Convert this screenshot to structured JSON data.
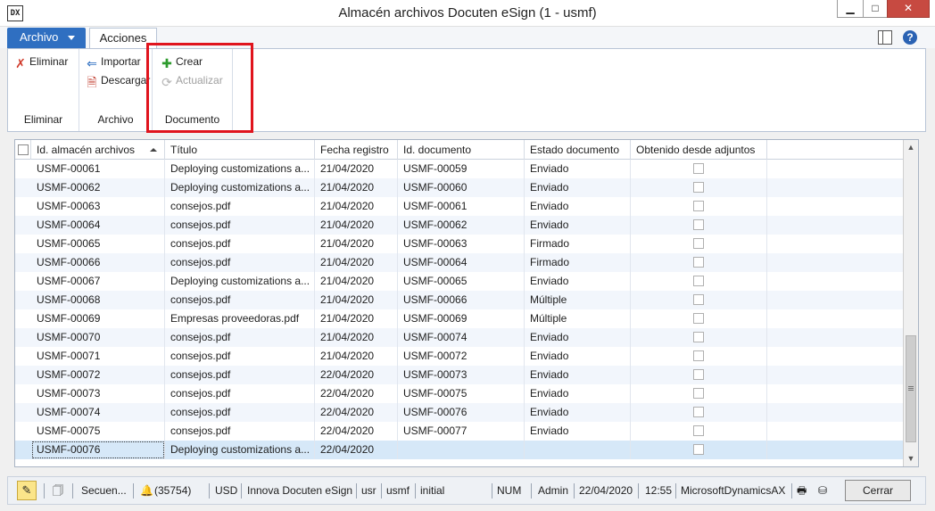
{
  "window": {
    "title": "Almacén archivos Docuten eSign (1 - usmf)",
    "app_icon": "DX",
    "minimize": "▁",
    "maximize": "□",
    "close": "✕"
  },
  "tabs": {
    "file_label": "Archivo",
    "actions_label": "Acciones",
    "help": "?"
  },
  "ribbon": {
    "groups": [
      {
        "title": "Eliminar",
        "buttons": [
          {
            "label": "Eliminar",
            "icon": "delete-icon",
            "enabled": true
          }
        ]
      },
      {
        "title": "Archivo",
        "buttons": [
          {
            "label": "Importar",
            "icon": "import-arrow-icon",
            "enabled": true
          },
          {
            "label": "Descargar",
            "icon": "download-document-icon",
            "enabled": true
          }
        ]
      },
      {
        "title": "Documento",
        "buttons": [
          {
            "label": "Crear",
            "icon": "create-new-icon",
            "enabled": true
          },
          {
            "label": "Actualizar",
            "icon": "refresh-document-icon",
            "enabled": false
          }
        ]
      }
    ]
  },
  "grid": {
    "columns": [
      "Id. almacén archivos",
      "Título",
      "Fecha registro",
      "Id. documento",
      "Estado documento",
      "Obtenido desde adjuntos"
    ],
    "rows": [
      {
        "id": "USMF-00061",
        "title": "Deploying customizations a...",
        "date": "21/04/2020",
        "doc": "USMF-00059",
        "status": "Enviado"
      },
      {
        "id": "USMF-00062",
        "title": "Deploying customizations a...",
        "date": "21/04/2020",
        "doc": "USMF-00060",
        "status": "Enviado"
      },
      {
        "id": "USMF-00063",
        "title": "consejos.pdf",
        "date": "21/04/2020",
        "doc": "USMF-00061",
        "status": "Enviado"
      },
      {
        "id": "USMF-00064",
        "title": "consejos.pdf",
        "date": "21/04/2020",
        "doc": "USMF-00062",
        "status": "Enviado"
      },
      {
        "id": "USMF-00065",
        "title": "consejos.pdf",
        "date": "21/04/2020",
        "doc": "USMF-00063",
        "status": "Firmado"
      },
      {
        "id": "USMF-00066",
        "title": "consejos.pdf",
        "date": "21/04/2020",
        "doc": "USMF-00064",
        "status": "Firmado"
      },
      {
        "id": "USMF-00067",
        "title": "Deploying customizations a...",
        "date": "21/04/2020",
        "doc": "USMF-00065",
        "status": "Enviado"
      },
      {
        "id": "USMF-00068",
        "title": "consejos.pdf",
        "date": "21/04/2020",
        "doc": "USMF-00066",
        "status": "Múltiple"
      },
      {
        "id": "USMF-00069",
        "title": "Empresas proveedoras.pdf",
        "date": "21/04/2020",
        "doc": "USMF-00069",
        "status": "Múltiple"
      },
      {
        "id": "USMF-00070",
        "title": "consejos.pdf",
        "date": "21/04/2020",
        "doc": "USMF-00074",
        "status": "Enviado"
      },
      {
        "id": "USMF-00071",
        "title": "consejos.pdf",
        "date": "21/04/2020",
        "doc": "USMF-00072",
        "status": "Enviado"
      },
      {
        "id": "USMF-00072",
        "title": "consejos.pdf",
        "date": "22/04/2020",
        "doc": "USMF-00073",
        "status": "Enviado"
      },
      {
        "id": "USMF-00073",
        "title": "consejos.pdf",
        "date": "22/04/2020",
        "doc": "USMF-00075",
        "status": "Enviado"
      },
      {
        "id": "USMF-00074",
        "title": "consejos.pdf",
        "date": "22/04/2020",
        "doc": "USMF-00076",
        "status": "Enviado"
      },
      {
        "id": "USMF-00075",
        "title": "consejos.pdf",
        "date": "22/04/2020",
        "doc": "USMF-00077",
        "status": "Enviado"
      },
      {
        "id": "USMF-00076",
        "title": "Deploying customizations a...",
        "date": "22/04/2020",
        "doc": "",
        "status": ""
      }
    ],
    "selected_row_id": "USMF-00076"
  },
  "statusbar": {
    "sequence": "Secuen...",
    "alerts": "(35754)",
    "currency": "USD",
    "model": "Innova Docuten eSign",
    "layer": "usr",
    "company": "usmf",
    "state": "initial",
    "numlock": "NUM",
    "user": "Admin",
    "date": "22/04/2020",
    "time": "12:55",
    "instance": "MicrosoftDynamicsAX",
    "close_label": "Cerrar"
  },
  "colors": {
    "accent": "#2f6fc1",
    "highlight_box": "#e0141d",
    "selected_row": "#d6e8f8",
    "alt_row": "#f2f6fc"
  }
}
